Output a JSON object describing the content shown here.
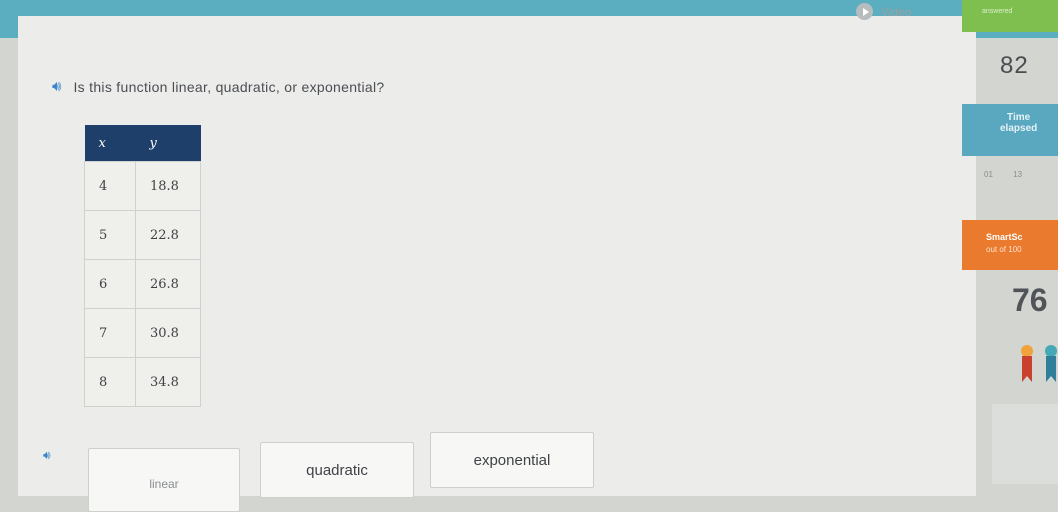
{
  "header": {
    "video_label": "Video"
  },
  "question": {
    "text": "Is this function linear, quadratic, or exponential?"
  },
  "table": {
    "headers": [
      "x",
      "y"
    ],
    "rows": [
      [
        "4",
        "18.8"
      ],
      [
        "5",
        "22.8"
      ],
      [
        "6",
        "26.8"
      ],
      [
        "7",
        "30.8"
      ],
      [
        "8",
        "34.8"
      ]
    ]
  },
  "answers": {
    "linear": "linear",
    "quadratic": "quadratic",
    "exponential": "exponential"
  },
  "sidebar": {
    "answered_label": "answered",
    "count": "82",
    "time_label_1": "Time",
    "time_label_2": "elapsed",
    "time_digits": [
      "01",
      "13"
    ],
    "smartscore_label": "SmartSc",
    "smartscore_sub": "out of 100",
    "score": "76"
  },
  "colors": {
    "accent_blue": "#5aaebf",
    "table_header": "#1f3f6b",
    "answered_green": "#7fbf50",
    "smart_orange": "#e97a2e"
  }
}
